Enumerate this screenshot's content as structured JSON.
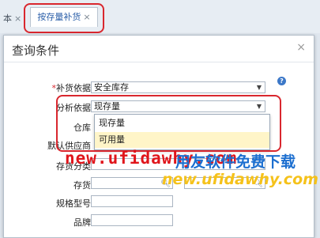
{
  "tabs": {
    "previous_label": "本",
    "active_label": "按存量补货",
    "close_glyph": "×"
  },
  "dialog": {
    "title": "查询条件",
    "close_glyph": "×",
    "help_glyph": "?",
    "fields": {
      "replenish_basis": {
        "required_mark": "*",
        "label": "补货依据",
        "value": "安全库存"
      },
      "analysis_basis": {
        "label": "分析依据",
        "value": "现存量"
      },
      "warehouse": {
        "label": "仓库"
      },
      "default_supplier": {
        "label": "默认供应商"
      },
      "inventory_category": {
        "label": "存货分类"
      },
      "inventory": {
        "label": "存货"
      },
      "spec_model": {
        "label": "规格型号"
      },
      "brand": {
        "label": "品牌"
      }
    },
    "dropdown_options": [
      "现存量",
      "可用量"
    ],
    "selected_option": "可用量"
  },
  "watermark": {
    "url_red": "new.ufidawhy.com",
    "slogan": "用友软件免费下载",
    "url_yellow": "new.ufidawhy.com"
  },
  "colors": {
    "highlight": "#d9272e",
    "option_highlight": "#fff5c8",
    "tab_text": "#2a5ea8"
  }
}
